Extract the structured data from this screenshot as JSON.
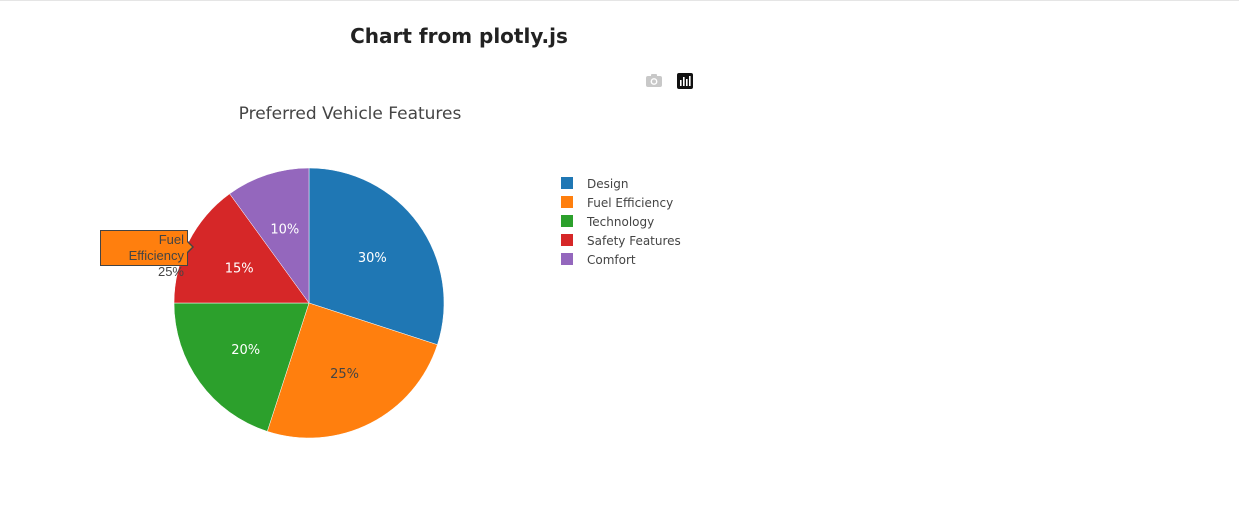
{
  "page": {
    "heading": "Chart from plotly.js"
  },
  "modebar": {
    "icons": [
      "camera-icon",
      "plotly-logo-icon"
    ]
  },
  "tooltip": {
    "label": "Fuel Efficiency",
    "value": "25%"
  },
  "chart_data": {
    "type": "pie",
    "title": "Preferred Vehicle Features",
    "categories": [
      "Design",
      "Fuel Efficiency",
      "Technology",
      "Safety Features",
      "Comfort"
    ],
    "values": [
      30,
      25,
      20,
      15,
      10
    ],
    "labels": [
      "30%",
      "25%",
      "20%",
      "15%",
      "10%"
    ],
    "colors": [
      "#1f77b4",
      "#ff7f0e",
      "#2ca02c",
      "#d62728",
      "#9467bd"
    ],
    "label_colors": [
      "#ffffff",
      "#444444",
      "#ffffff",
      "#ffffff",
      "#ffffff"
    ],
    "direction": "clockwise",
    "start_angle_deg": 90,
    "legend": "right"
  }
}
